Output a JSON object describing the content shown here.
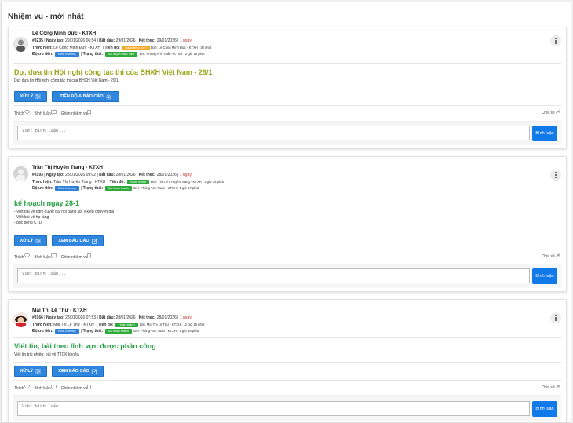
{
  "panel": {
    "title": "Nhiệm vụ - mới nhất"
  },
  "labels": {
    "created": "Ngày tạo:",
    "start": "Bắt đầu:",
    "end": "Kết thúc:",
    "assignee": "Thực hiện:",
    "progress": "Tiến độ:",
    "priority": "Độ ưu tiên:",
    "status": "Trạng thái:",
    "by": "Bởi:",
    "like": "Thích",
    "comment": "Bình luận",
    "pin": "Ghim nhiệm vụ",
    "share": "Chia sẻ",
    "comment_placeholder": "Viết bình luận...",
    "comment_button": "Bình luận",
    "handle_button": "XỬ LÝ"
  },
  "posts": [
    {
      "author": "Lê Công Minh Đức - KTXH",
      "id": "#3235",
      "created": "29/01/2026 06:54",
      "start": "29/01/2026",
      "end": "29/01/2026",
      "duration": "1 ngày",
      "assignee": "Lê Công Minh Đức - KTXH",
      "progress_badge": "Đang thực hiện",
      "progress_by": "Bởi: Lê Công Minh Đức - KTXH : 30 phút",
      "priority_badge": "Bình thường",
      "status_badge": "Đã duyệt thực hiện",
      "status_by": "Bởi: Phùng Anh Tuấn - KTXH : 2 giờ 29 phút",
      "title": "Dự, đưa tin Hội nghị công tác thi của BHXH Việt Nam - 29/1",
      "desc": [
        "Dự, đưa tin Hội nghị công tác thi của BHXH Việt Nam - 29/1"
      ],
      "second_button": "TIẾN ĐỘ & BÁO CÁO"
    },
    {
      "author": "Trần Thị Huyền Trang - KTXH",
      "id": "#3193",
      "created": "28/01/2026 09:02",
      "start": "28/01/2026",
      "end": "28/01/2026",
      "duration": "1 ngày",
      "assignee": "Trần Thị Huyền Trang - KTXH",
      "progress_badge": "Hoàn thành",
      "progress_by": "Bởi: Trần Thị Huyền Trang - KTXH : 2 giờ 18 phút",
      "priority_badge": "Bình thường",
      "status_badge": "Đã hoàn thành",
      "status_by": "Bởi: Phùng Anh Tuấn - KTXH : 1 giờ 17 phút",
      "title": "kế hoạch ngày 28-1",
      "desc": [
        "- Viết bài về nghị quyết đại hội đảng lấy ý kiến chuyên gia",
        "- Viết bài về hạ tầng",
        "- duc bóng CTD"
      ],
      "second_button": "XEM BÁO CÁO"
    },
    {
      "author": "Mai Thị Lệ Thư - KTXH",
      "id": "#3166",
      "created": "28/01/2026 07:53",
      "start": "28/01/2026",
      "end": "28/01/2026",
      "duration": "1 ngày",
      "assignee": "Mai Thị Lệ Thư - KTXH",
      "progress_badge": "Hoàn thành",
      "progress_by": "Bởi: Mai Thị Lệ Thư - KTXH : 12 giờ 25 phút",
      "priority_badge": "Bình thường",
      "status_badge": "Đã hoàn thành",
      "status_by": "Bởi: Phùng Anh Tuấn - KTXH : 1 giờ 18 phút",
      "title": "Viết tin, bài theo lĩnh vực được phân công",
      "desc": [
        "Viết tin trải phiếu; bài về TTCK khoẻa"
      ],
      "second_button": "XEM BÁO CÁO"
    }
  ]
}
